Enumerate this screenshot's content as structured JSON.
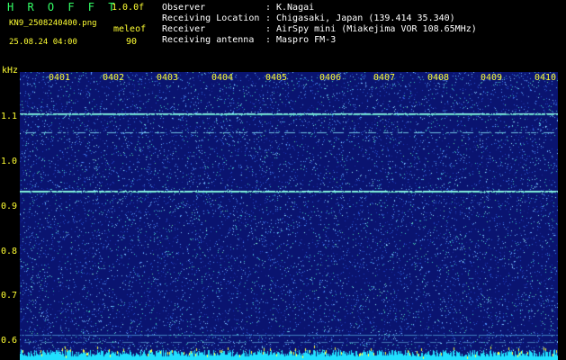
{
  "app": {
    "title": "H R O F F T",
    "version": "1.0.0f"
  },
  "file": {
    "name": "KN9_2508240400.png",
    "datetime": "25.08.24 04:00"
  },
  "settings": {
    "mode": "meleof",
    "value": "90"
  },
  "info": [
    {
      "label": "Observer",
      "value": "K.Nagai"
    },
    {
      "label": "Receiving Location",
      "value": "Chigasaki, Japan (139.414 35.340)"
    },
    {
      "label": "Receiver",
      "value": "AirSpy mini (Miakejima VOR 108.65MHz)"
    },
    {
      "label": "Receiving antenna",
      "value": "Maspro FM-3"
    }
  ],
  "axis": {
    "y_unit": "kHz",
    "y_ticks": [
      "1.1",
      "1.0",
      "0.9",
      "0.8",
      "0.7",
      "0.6"
    ],
    "x_ticks": [
      "0401",
      "0402",
      "0403",
      "0404",
      "0405",
      "0406",
      "0407",
      "0408",
      "0409",
      "0410"
    ]
  },
  "colors": {
    "background": "#0a1470",
    "label": "#ffff33",
    "title": "#33ff66"
  }
}
